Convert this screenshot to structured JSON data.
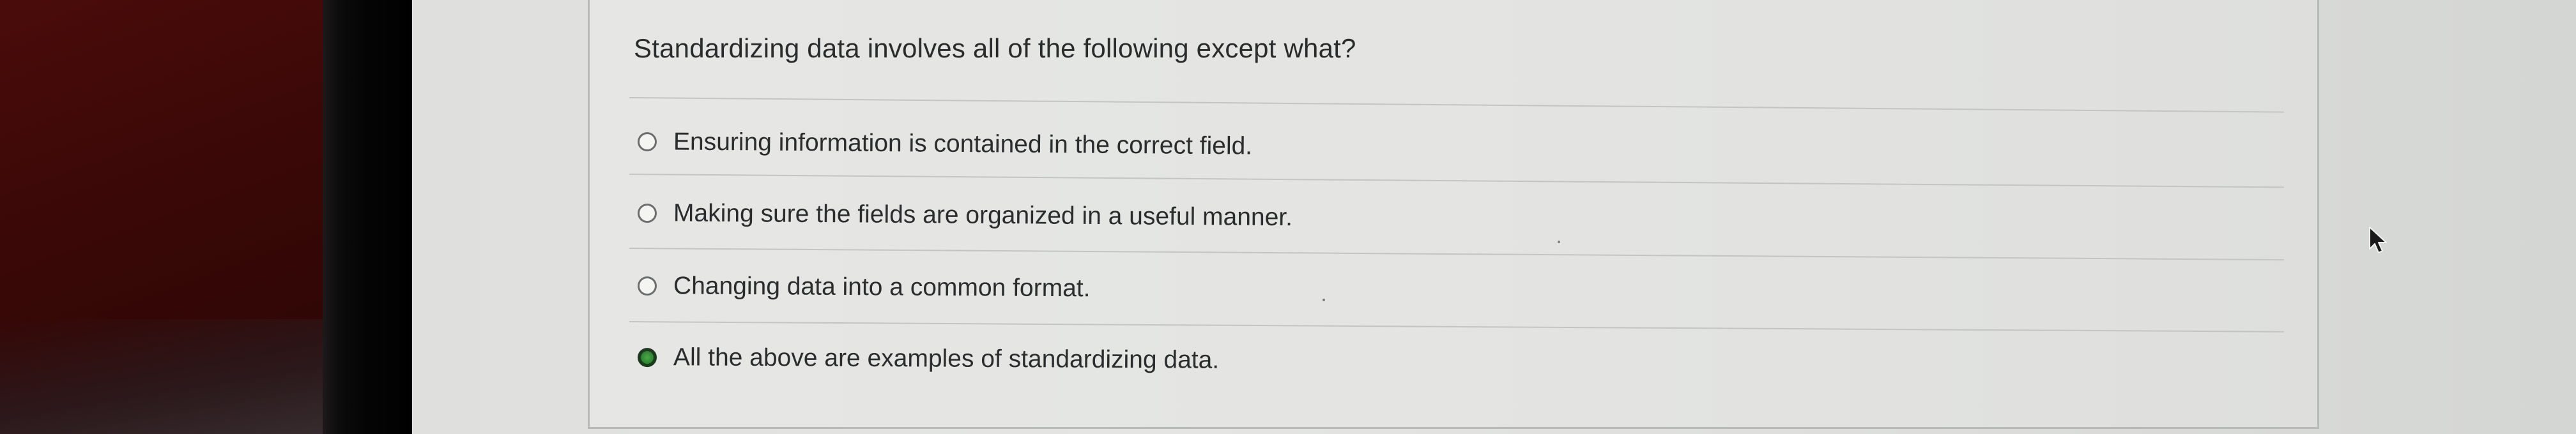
{
  "question": {
    "text": "Standardizing data involves all of the following except what?"
  },
  "options": [
    {
      "label": "Ensuring information is contained in the correct field.",
      "selected": false
    },
    {
      "label": "Making sure the fields are organized in a useful manner.",
      "selected": false
    },
    {
      "label": "Changing data into a common format.",
      "selected": false
    },
    {
      "label": "All the above are examples of standardizing data.",
      "selected": true
    }
  ],
  "colors": {
    "selected_radio": "#2f8a33",
    "text": "#2b2c2e",
    "divider": "#c3c5c2"
  },
  "icons": {
    "cursor": "mouse-pointer-icon",
    "radio": "radio-button-icon"
  }
}
